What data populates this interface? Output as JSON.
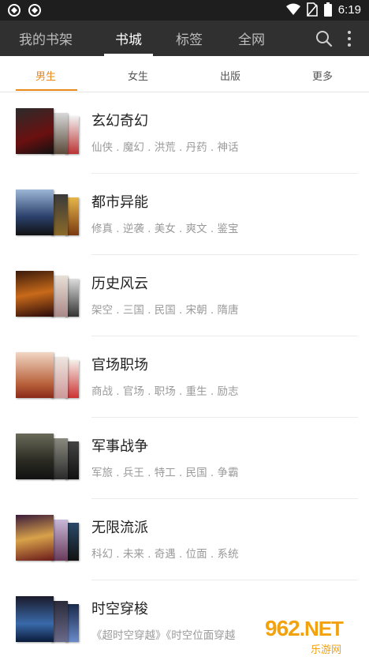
{
  "status_bar": {
    "time": "6:19"
  },
  "top_tabs": [
    {
      "label": "我的书架"
    },
    {
      "label": "书城"
    },
    {
      "label": "标签"
    },
    {
      "label": "全网"
    }
  ],
  "sub_tabs": [
    {
      "label": "男生"
    },
    {
      "label": "女生"
    },
    {
      "label": "出版"
    },
    {
      "label": "更多"
    }
  ],
  "categories": [
    {
      "title": "玄幻奇幻",
      "subtitle": "仙侠 . 魔幻 . 洪荒 . 丹药 . 神话"
    },
    {
      "title": "都市异能",
      "subtitle": "修真 . 逆袭 . 美女 . 爽文 . 鉴宝"
    },
    {
      "title": "历史风云",
      "subtitle": "架空 . 三国 . 民国 . 宋朝 . 隋唐"
    },
    {
      "title": "官场职场",
      "subtitle": "商战 . 官场 . 职场 . 重生 . 励志"
    },
    {
      "title": "军事战争",
      "subtitle": "军旅 . 兵王 . 特工 . 民国 . 争霸"
    },
    {
      "title": "无限流派",
      "subtitle": "科幻 . 未来 . 奇遇 . 位面 . 系统"
    },
    {
      "title": "时空穿梭",
      "subtitle": "《超时空穿越》《时空位面穿越"
    }
  ],
  "watermark": {
    "logo": "962",
    "logo_suffix": ".NET",
    "text": "乐游网"
  },
  "colors": {
    "accent": "#e8891d",
    "app_bar": "#303030",
    "status_bar": "#1e1e1e"
  }
}
